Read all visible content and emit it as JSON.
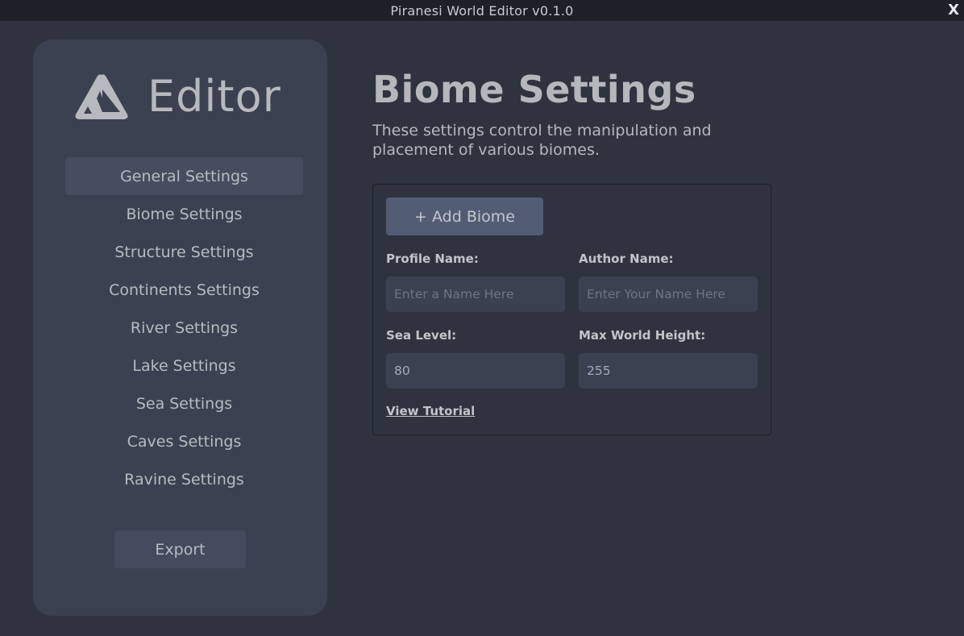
{
  "window": {
    "title": "Piranesi World Editor v0.1.0",
    "close_label": "X"
  },
  "sidebar": {
    "brand_name": "Editor",
    "logo_icon": "mountain-triangle-logo",
    "items": [
      {
        "label": "General Settings",
        "active": true
      },
      {
        "label": "Biome Settings",
        "active": false
      },
      {
        "label": "Structure Settings",
        "active": false
      },
      {
        "label": "Continents Settings",
        "active": false
      },
      {
        "label": "River Settings",
        "active": false
      },
      {
        "label": "Lake Settings",
        "active": false
      },
      {
        "label": "Sea Settings",
        "active": false
      },
      {
        "label": "Caves Settings",
        "active": false
      },
      {
        "label": "Ravine Settings",
        "active": false
      }
    ],
    "export_label": "Export"
  },
  "main": {
    "title": "Biome Settings",
    "description": "These settings control the manipulation and placement of various biomes.",
    "panel": {
      "add_button_label": "+ Add Biome",
      "profile_name": {
        "label": "Profile Name:",
        "value": "",
        "placeholder": "Enter a Name Here"
      },
      "author_name": {
        "label": "Author Name:",
        "value": "",
        "placeholder": "Enter Your Name Here"
      },
      "sea_level": {
        "label": "Sea Level:",
        "value": "80",
        "placeholder": ""
      },
      "max_world_height": {
        "label": "Max World Height:",
        "value": "255",
        "placeholder": ""
      },
      "tutorial_link": "View Tutorial"
    }
  },
  "colors": {
    "background": "#2e333f",
    "titlebar": "#1d2028",
    "sidebar": "#3b4150",
    "active_item": "#454d5f",
    "primary_button": "#535c75",
    "text": "#b5b8bf"
  }
}
